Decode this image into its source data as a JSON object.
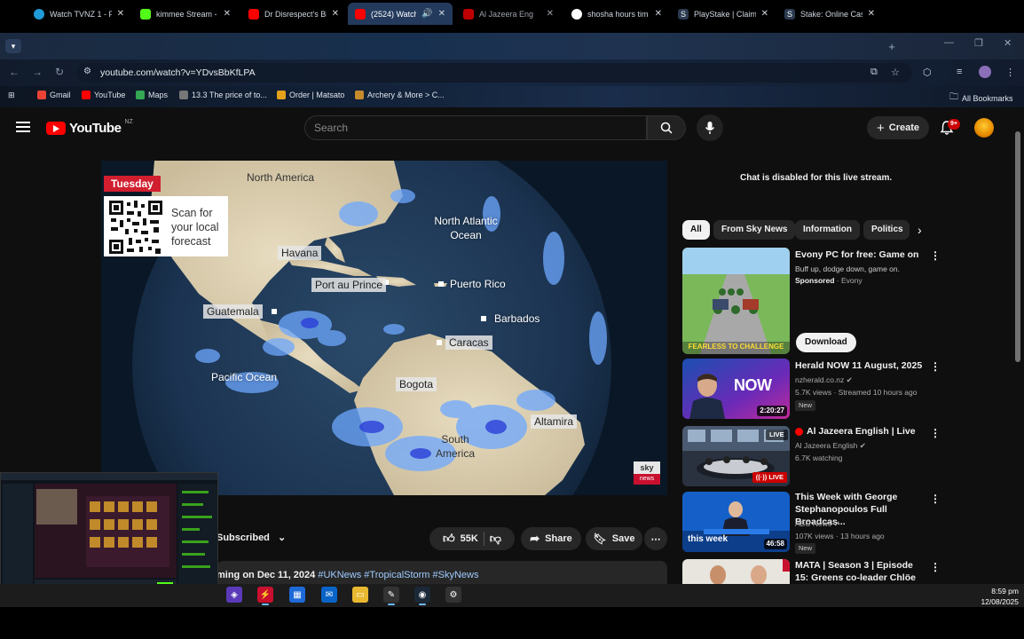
{
  "browser": {
    "tabs": [
      {
        "title": "Watch TVNZ 1 - Fr",
        "color": "#1e9bd7"
      },
      {
        "title": "kimmee Stream -",
        "color": "#53fc18"
      },
      {
        "title": "Dr Disrespect's Bl",
        "color": "#ff0000"
      },
      {
        "title": "(2524) Watch",
        "color": "#ff0000"
      },
      {
        "title": "Al Jazeera Eng",
        "color": "#ff0000"
      },
      {
        "title": "shosha hours tim",
        "color": "#4285f4"
      },
      {
        "title": "PlayStake | Claim",
        "color": "#222222"
      },
      {
        "title": "Stake: Online Cas",
        "color": "#222222"
      }
    ],
    "url": "youtube.com/watch?v=YDvsBbKfLPA",
    "bookmarks": [
      {
        "label": "Gmail",
        "color": "#ea4335"
      },
      {
        "label": "YouTube",
        "color": "#ff0000"
      },
      {
        "label": "Maps",
        "color": "#34a853"
      },
      {
        "label": "13.3 The price of to...",
        "color": "#777777"
      },
      {
        "label": "Order | Matsato",
        "color": "#e3a21a"
      },
      {
        "label": "Archery & More > C...",
        "color": "#c58b2b"
      }
    ],
    "all_bookmarks": "All Bookmarks"
  },
  "youtube": {
    "logo": "YouTube",
    "country": "NZ",
    "search_placeholder": "Search",
    "create_label": "Create",
    "notifications": "9+"
  },
  "video": {
    "day": "Tuesday",
    "qr_text": "Scan for your local forecast",
    "labels": {
      "north_america": "North America",
      "north_atlantic": "North Atlantic Ocean",
      "havana": "Havana",
      "port_au_prince": "Port au Prince",
      "puerto_rico": "Puerto Rico",
      "guatemala": "Guatemala",
      "barbados": "Barbados",
      "caracas": "Caracas",
      "pacific": "Pacific Ocean",
      "bogota": "Bogota",
      "altamira": "Altamira",
      "south_america": "South America"
    },
    "sky_top": "sky",
    "sky_bottom": "news"
  },
  "actions": {
    "subscribed": "Subscribed",
    "likes": "55K",
    "share": "Share",
    "save": "Save"
  },
  "description": {
    "text": "ming on Dec 11, 2024",
    "tags": "#UKNews #TropicalStorm #SkyNews"
  },
  "sidebar": {
    "chat_disabled": "Chat is disabled for this live stream.",
    "chips": [
      "All",
      "From Sky News",
      "Information",
      "Politics"
    ],
    "recommendations": [
      {
        "title": "Evony PC for free: Game on",
        "line1": "Buff up, dodge down, game on.",
        "sponsored": "Sponsored",
        "advertiser": "Evony",
        "cta": "Download",
        "thumb_caption": "FEARLESS TO CHALLENGE"
      },
      {
        "title": "Herald NOW 11 August, 2025",
        "channel": "nzherald.co.nz",
        "meta": "5.7K views · Streamed 10 hours ago",
        "badge": "New",
        "duration": "2:20:27",
        "thumb_text": "NOW"
      },
      {
        "title": "Al Jazeera English | Live",
        "channel": "Al Jazeera English",
        "meta": "6.7K watching",
        "live": "LIVE"
      },
      {
        "title": "This Week with George Stephanopoulos Full Broadcas...",
        "channel": "ABC News",
        "meta": "107K views · 13 hours ago",
        "badge": "New",
        "duration": "46:58",
        "thumb_text": "this week"
      },
      {
        "title": "MATA | Season 3 | Episode 15: Greens co-leader Chlöe ..."
      }
    ]
  },
  "taskbar": {
    "time": "8:59 pm",
    "date": "12/08/2025"
  }
}
